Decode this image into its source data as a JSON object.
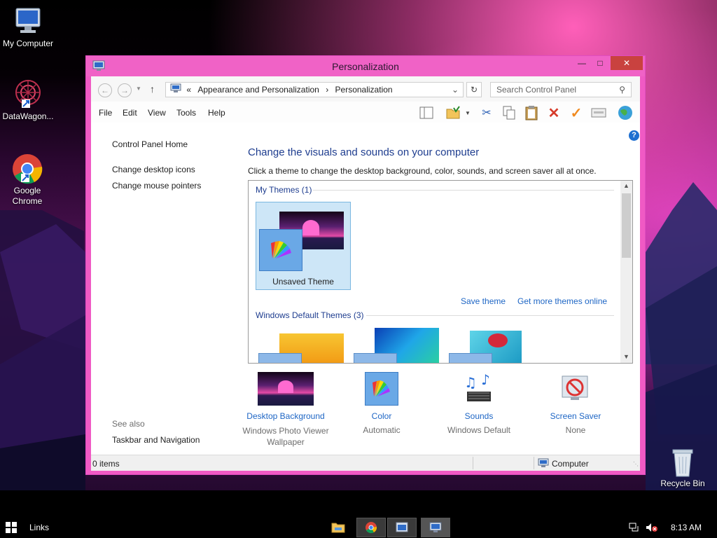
{
  "desktop": {
    "icons": [
      {
        "label": "My Computer"
      },
      {
        "label": "DataWagon..."
      },
      {
        "label": "Google Chrome"
      },
      {
        "label": "Recycle Bin"
      }
    ]
  },
  "window": {
    "title": "Personalization",
    "address": {
      "prefix": "«",
      "crumb1": "Appearance and Personalization",
      "sep": "›",
      "crumb2": "Personalization"
    },
    "search_placeholder": "Search Control Panel",
    "menu": [
      "File",
      "Edit",
      "View",
      "Tools",
      "Help"
    ],
    "left_pane": {
      "home": "Control Panel Home",
      "links": [
        "Change desktop icons",
        "Change mouse pointers"
      ],
      "see_also": "See also",
      "see_also_links": [
        "Taskbar and Navigation"
      ]
    },
    "main": {
      "heading": "Change the visuals and sounds on your computer",
      "subheading": "Click a theme to change the desktop background, color, sounds, and screen saver all at once.",
      "my_themes_label": "My Themes (1)",
      "unsaved_theme": "Unsaved Theme",
      "save_theme": "Save theme",
      "get_more": "Get more themes online",
      "default_themes_label": "Windows Default Themes (3)"
    },
    "bottom_items": [
      {
        "label": "Desktop Background",
        "value": "Windows Photo Viewer Wallpaper"
      },
      {
        "label": "Color",
        "value": "Automatic"
      },
      {
        "label": "Sounds",
        "value": "Windows Default"
      },
      {
        "label": "Screen Saver",
        "value": "None"
      }
    ],
    "status": {
      "items": "0 items",
      "location": "Computer"
    }
  },
  "taskbar": {
    "links": "Links",
    "time": "8:13 AM"
  },
  "colors": {
    "window_frame": "#f05ac4",
    "link_blue": "#1e66c5",
    "heading_blue": "#1e3d8f",
    "close_red": "#c9423f"
  }
}
